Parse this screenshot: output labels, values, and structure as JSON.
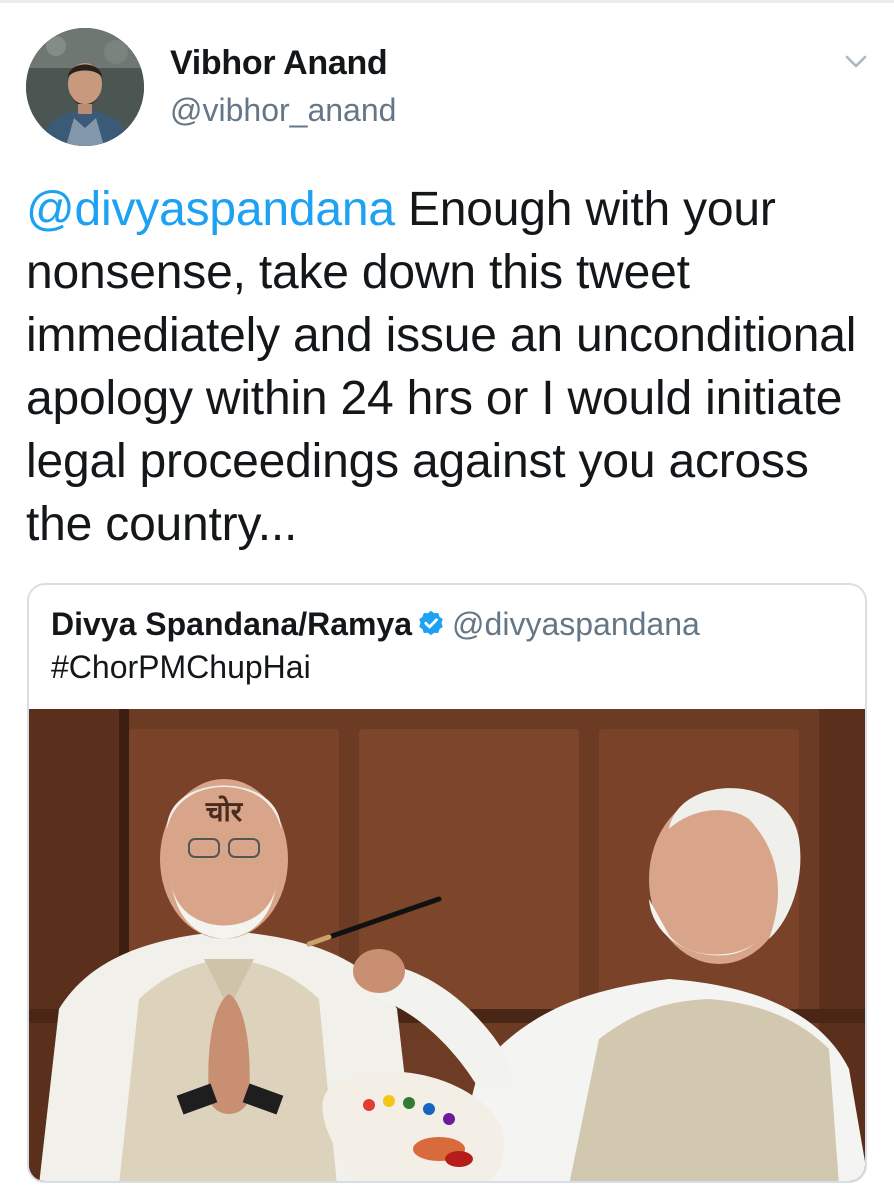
{
  "author": {
    "name": "Vibhor Anand",
    "handle": "@vibhor_anand",
    "avatar_icon": "profile-photo"
  },
  "menu_icon": "chevron-down-icon",
  "tweet": {
    "mention": "@divyaspandana",
    "text": " Enough with your nonsense, take down this tweet immediately and issue an unconditional apology within 24 hrs or I would initiate legal proceedings against you across the country..."
  },
  "quoted": {
    "name": "Divya Spandana/Ramya",
    "verified_icon": "verified-badge-icon",
    "handle": "@divyaspandana",
    "text": "#ChorPMChupHai",
    "media_forehead_text": "चोर"
  },
  "colors": {
    "link": "#1da1f2",
    "text": "#14171a",
    "secondary": "#657786",
    "border": "#d8dfe4"
  }
}
